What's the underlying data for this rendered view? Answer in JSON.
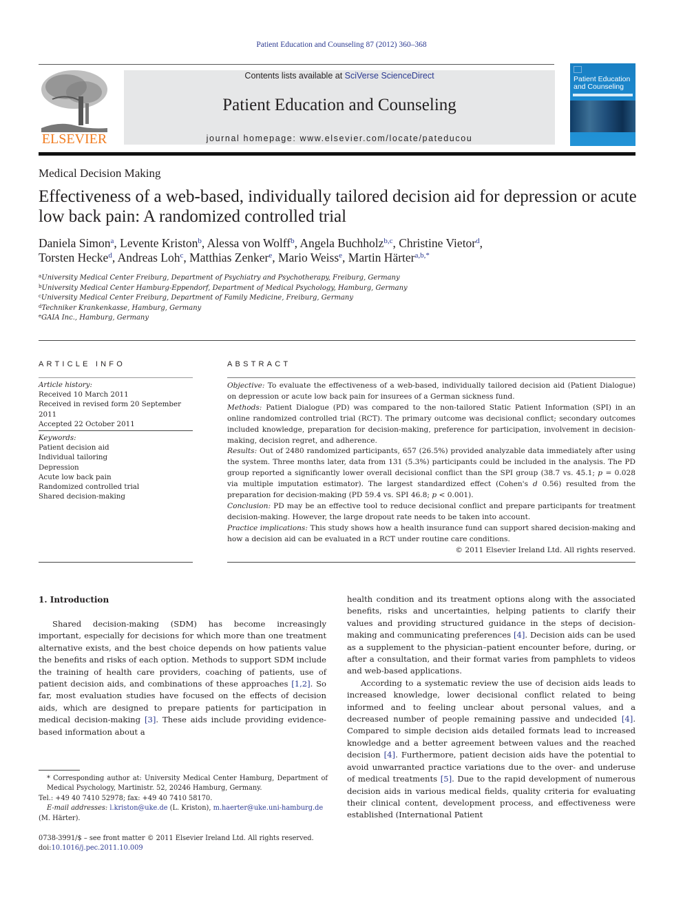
{
  "running_head": "Patient Education and Counseling 87 (2012) 360–368",
  "masthead": {
    "publisher_logo_text": "ELSEVIER",
    "contents_prefix": "Contents lists available at ",
    "contents_link": "SciVerse ScienceDirect",
    "journal_title": "Patient Education and Counseling",
    "homepage": "journal homepage: www.elsevier.com/locate/pateducou",
    "cover_title_line1": "Patient Education",
    "cover_title_line2": "and Counseling",
    "colors": {
      "publisher_orange": "#f07c20",
      "link_blue": "#2b3990",
      "masthead_gray": "#e6e7e8",
      "cover_blue": "#1b8ad0"
    }
  },
  "article": {
    "section": "Medical Decision Making",
    "title": "Effectiveness of a web-based, individually tailored decision aid for depression or acute low back pain: A randomized controlled trial",
    "authors": [
      {
        "name": "Daniela Simon",
        "aff": "a",
        "sep": ", "
      },
      {
        "name": "Levente Kriston",
        "aff": "b",
        "sep": ", "
      },
      {
        "name": "Alessa von Wolff",
        "aff": "b",
        "sep": ", "
      },
      {
        "name": "Angela Buchholz",
        "aff": "b,c",
        "sep": ", "
      },
      {
        "name": "Christine Vietor",
        "aff": "d",
        "sep": ","
      },
      {
        "name": "Torsten Hecke",
        "aff": "d",
        "sep": ", "
      },
      {
        "name": "Andreas Loh",
        "aff": "c",
        "sep": ", "
      },
      {
        "name": "Matthias Zenker",
        "aff": "e",
        "sep": ", "
      },
      {
        "name": "Mario Weiss",
        "aff": "e",
        "sep": ", "
      },
      {
        "name": "Martin Härter",
        "aff": "a,b,*",
        "sep": ""
      }
    ],
    "affiliations": [
      {
        "key": "a",
        "text": "University Medical Center Freiburg, Department of Psychiatry and Psychotherapy, Freiburg, Germany"
      },
      {
        "key": "b",
        "text": "University Medical Center Hamburg-Eppendorf, Department of Medical Psychology, Hamburg, Germany"
      },
      {
        "key": "c",
        "text": "University Medical Center Freiburg, Department of Family Medicine, Freiburg, Germany"
      },
      {
        "key": "d",
        "text": "Techniker Krankenkasse, Hamburg, Germany"
      },
      {
        "key": "e",
        "text": "GAIA Inc., Hamburg, Germany"
      }
    ]
  },
  "article_info": {
    "heading": "ARTICLE INFO",
    "history_label": "Article history:",
    "history": [
      "Received 10 March 2011",
      "Received in revised form 20 September 2011",
      "Accepted 22 October 2011"
    ],
    "keywords_label": "Keywords:",
    "keywords": [
      "Patient decision aid",
      "Individual tailoring",
      "Depression",
      "Acute low back pain",
      "Randomized controlled trial",
      "Shared decision-making"
    ]
  },
  "abstract": {
    "heading": "ABSTRACT",
    "objective_label": "Objective:",
    "objective": " To evaluate the effectiveness of a web-based, individually tailored decision aid (Patient Dialogue) on depression or acute low back pain for insurees of a German sickness fund.",
    "methods_label": "Methods:",
    "methods": " Patient Dialogue (PD) was compared to the non-tailored Static Patient Information (SPI) in an online randomized controlled trial (RCT). The primary outcome was decisional conflict; secondary outcomes included knowledge, preparation for decision-making, preference for participation, involvement in decision-making, decision regret, and adherence.",
    "results_label": "Results:",
    "results_a": " Out of 2480 randomized participants, 657 (26.5%) provided analyzable data immediately after using the system. Three months later, data from 131 (5.3%) participants could be included in the analysis. The PD group reported a significantly lower overall decisional conflict than the SPI group (38.7 vs. 45.1; ",
    "results_p1": "p",
    "results_b": " = 0.028 via multiple imputation estimator). The largest standardized effect (Cohen's ",
    "results_d": "d",
    "results_c": " 0.56) resulted from the preparation for decision-making (PD 59.4 vs. SPI 46.8; ",
    "results_p2": "p",
    "results_e": " < 0.001).",
    "conclusion_label": "Conclusion:",
    "conclusion": " PD may be an effective tool to reduce decisional conflict and prepare participants for treatment decision-making. However, the large dropout rate needs to be taken into account.",
    "practice_label": "Practice implications:",
    "practice": " This study shows how a health insurance fund can support shared decision-making and how a decision aid can be evaluated in a RCT under routine care conditions.",
    "copyright": "© 2011 Elsevier Ireland Ltd. All rights reserved."
  },
  "body": {
    "intro_heading": "1.  Introduction",
    "left_p1_a": "Shared decision-making (SDM) has become increasingly important, especially for decisions for which more than one treatment alternative exists, and the best choice depends on how patients value the benefits and risks of each option. Methods to support SDM include the training of health care providers, coaching of patients, use of patient decision aids, and combinations of these approaches ",
    "left_ref_1": "[1,2]",
    "left_p1_b": ". So far, most evaluation studies have focused on the effects of decision aids, which are designed to prepare patients for participation in medical decision-making ",
    "left_ref_2": "[3]",
    "left_p1_c": ". These aids include providing evidence-based information about a",
    "right_p1_a": "health condition and its treatment options along with the associated benefits, risks and uncertainties, helping patients to clarify their values and providing structured guidance in the steps of decision-making and communicating preferences ",
    "right_ref_1": "[4]",
    "right_p1_b": ". Decision aids can be used as a supplement to the physician–patient encounter before, during, or after a consultation, and their format varies from pamphlets to videos and web-based applications.",
    "right_p2_a": "According to a systematic review the use of decision aids leads to increased knowledge, lower decisional conflict related to being informed and to feeling unclear about personal values, and a decreased number of people remaining passive and undecided ",
    "right_ref_2": "[4]",
    "right_p2_b": ". Compared to simple decision aids detailed formats lead to increased knowledge and a better agreement between values and the reached decision ",
    "right_ref_3": "[4]",
    "right_p2_c": ". Furthermore, patient decision aids have the potential to avoid unwarranted practice variations due to the over- and underuse of medical treatments ",
    "right_ref_4": "[5]",
    "right_p2_d": ". Due to the rapid development of numerous decision aids in various medical fields, quality criteria for evaluating their clinical content, development process, and effectiveness were established (International Patient"
  },
  "footnotes": {
    "corresponding": "* Corresponding author at: University Medical Center Hamburg, Department of Medical Psychology, Martinistr. 52, 20246 Hamburg, Germany.",
    "tel": "Tel.: +49 40 7410 52978; fax: +49 40 7410 58170.",
    "email_label": "E-mail addresses:",
    "email_1": "l.kriston@uke.de",
    "email_1_name": " (L. Kriston), ",
    "email_2": "m.haerter@uke.uni-hamburg.de",
    "email_2_name": "(M. Härter).",
    "front_matter": "0738-3991/$ – see front matter © 2011 Elsevier Ireland Ltd. All rights reserved.",
    "doi_prefix": "doi:",
    "doi": "10.1016/j.pec.2011.10.009"
  }
}
